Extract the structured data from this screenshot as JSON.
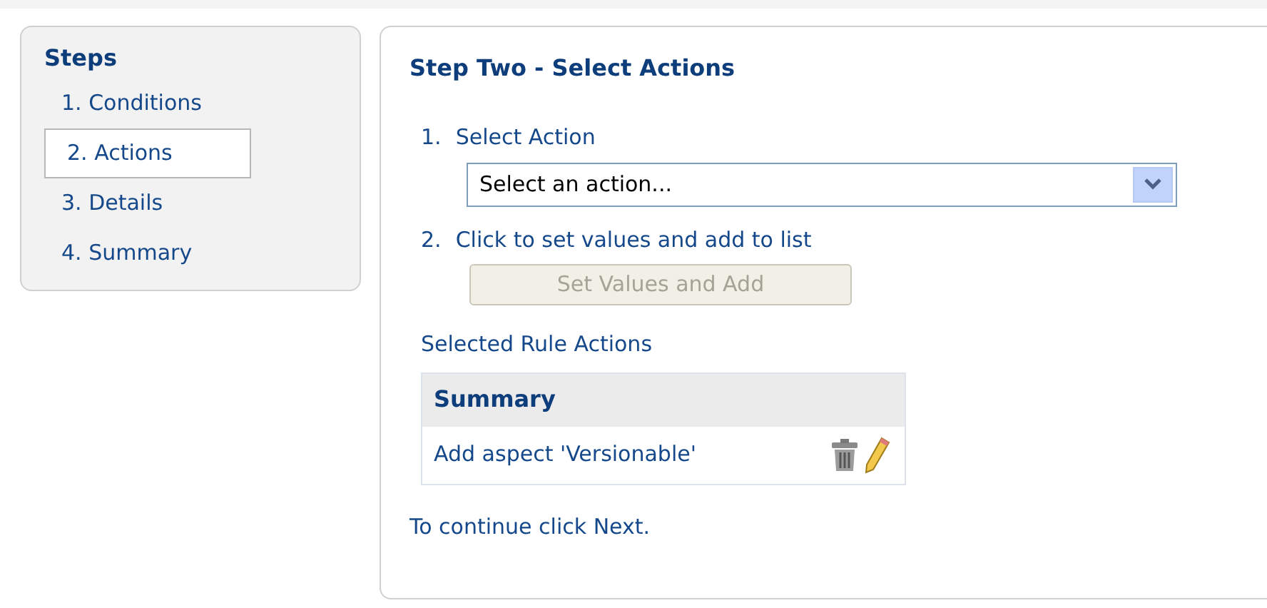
{
  "steps": {
    "title": "Steps",
    "items": [
      {
        "label": "1. Conditions",
        "selected": false
      },
      {
        "label": "2. Actions",
        "selected": true
      },
      {
        "label": "3. Details",
        "selected": false
      },
      {
        "label": "4. Summary",
        "selected": false
      }
    ]
  },
  "main": {
    "title": "Step Two - Select Actions",
    "step_1": {
      "number": "1.",
      "label": "Select Action",
      "dropdown": {
        "value": "Select an action..."
      }
    },
    "step_2": {
      "number": "2.",
      "label": "Click to set values and add to list",
      "button": {
        "label": "Set Values and Add",
        "disabled": true
      }
    },
    "selected_heading": "Selected Rule Actions",
    "table": {
      "columns": [
        "Summary"
      ],
      "rows": [
        {
          "summary": "Add aspect 'Versionable'"
        }
      ]
    },
    "footer": "To continue click Next."
  }
}
